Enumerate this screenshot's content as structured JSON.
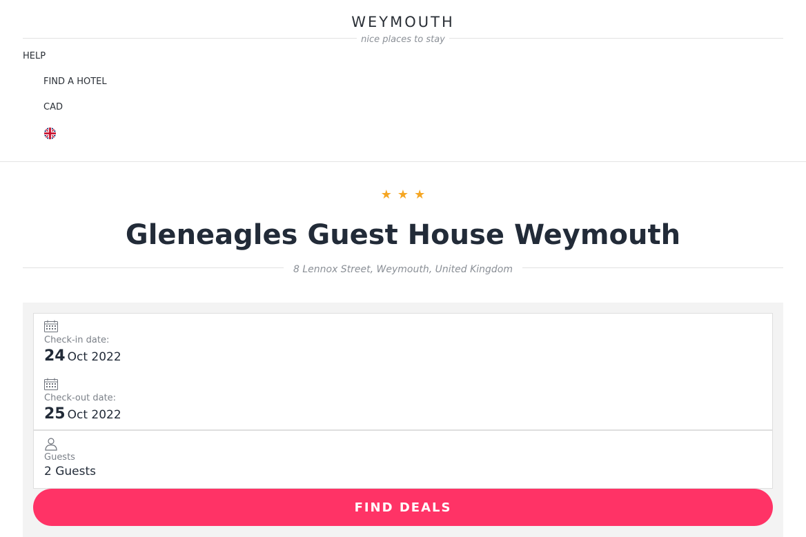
{
  "brand": {
    "name": "WEYMOUTH",
    "tagline": "nice places to stay"
  },
  "nav": {
    "help": "HELP",
    "find_hotel": "FIND A HOTEL",
    "currency": "CAD",
    "language_icon": "uk-flag-icon"
  },
  "hotel": {
    "star_rating": 3,
    "stars": [
      "★",
      "★",
      "★"
    ],
    "name": "Gleneagles Guest House Weymouth",
    "address": "8 Lennox Street, Weymouth, United Kingdom"
  },
  "search": {
    "checkin": {
      "icon": "calendar-icon",
      "label": "Check-in date:",
      "day": "24",
      "month_year": "Oct 2022"
    },
    "checkout": {
      "icon": "calendar-icon",
      "label": "Check-out date:",
      "day": "25",
      "month_year": "Oct 2022"
    },
    "guests": {
      "icon": "person-icon",
      "label": "Guests",
      "value": "2 Guests"
    },
    "button": "FIND DEALS"
  },
  "colors": {
    "accent": "#ff3366",
    "star": "#f5a623",
    "text": "#222b38",
    "muted": "#8a8f96"
  }
}
